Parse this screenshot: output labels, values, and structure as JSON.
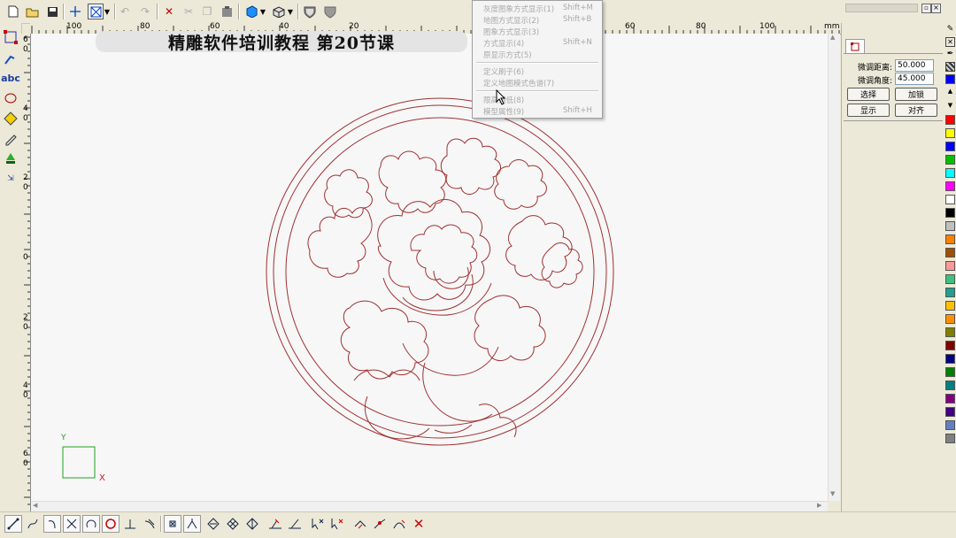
{
  "title": "精雕软件培训教程 第20节课",
  "ruler": {
    "unit": "mm",
    "top_labels": [
      "100",
      "80",
      "60",
      "40",
      "20",
      "60",
      "80",
      "100"
    ],
    "left_labels": [
      "6",
      "0",
      "4",
      "0",
      "2",
      "0",
      "0",
      "2",
      "0",
      "4",
      "0",
      "6",
      "0"
    ]
  },
  "menu": {
    "items": [
      {
        "label": "灰度图象方式显示(1)",
        "shortcut": "Shift+M"
      },
      {
        "label": "地图方式显示(2)",
        "shortcut": "Shift+B"
      },
      {
        "label": "图象方式显示(3)",
        "shortcut": ""
      },
      {
        "label": "方式显示(4)",
        "shortcut": "Shift+N"
      },
      {
        "label": "原显示方式(5)",
        "shortcut": ""
      },
      {
        "label": "定义刷子(6)",
        "shortcut": ""
      },
      {
        "label": "定义地图模式色谱(7)",
        "shortcut": ""
      },
      {
        "label": "限高调低(8)",
        "shortcut": ""
      },
      {
        "label": "模型属性(9)",
        "shortcut": "Shift+H"
      }
    ]
  },
  "panel": {
    "distance_label": "微调距离:",
    "distance_value": "50.000",
    "angle_label": "微调角度:",
    "angle_value": "45.000",
    "buttons": {
      "select": "选择",
      "add_lock": "加锁",
      "show": "显示",
      "align": "对齐"
    }
  },
  "axes": {
    "x_label": "X",
    "y_label": "Y"
  },
  "colors": {
    "accent": "#0a246a",
    "flower_stroke": "#a03030",
    "palette": [
      "#0000ff",
      "#ff0000",
      "#ffff00",
      "#0000ff",
      "#00c000",
      "#00ffff",
      "#ff00ff",
      "#ffffff",
      "#000000",
      "#c0c0c0",
      "#ff8000",
      "#a05000",
      "#ff9999",
      "#40c080",
      "#20a090",
      "#ffc000",
      "#ff9000",
      "#808000",
      "#800000",
      "#000080",
      "#008000",
      "#008080",
      "#800080",
      "#400080",
      "#6080c0",
      "#808080"
    ]
  },
  "toolbar_icons": [
    "new-file-icon",
    "open-folder-icon",
    "save-icon",
    "crosshair-icon",
    "select-box-icon",
    "undo-icon",
    "redo-icon",
    "delete-icon",
    "cut-icon",
    "copy-icon",
    "paste-icon",
    "render-cube-icon",
    "view-3d-icon",
    "shield-icon",
    "shield-filled-icon"
  ],
  "window_controls": [
    "restore",
    "close"
  ]
}
